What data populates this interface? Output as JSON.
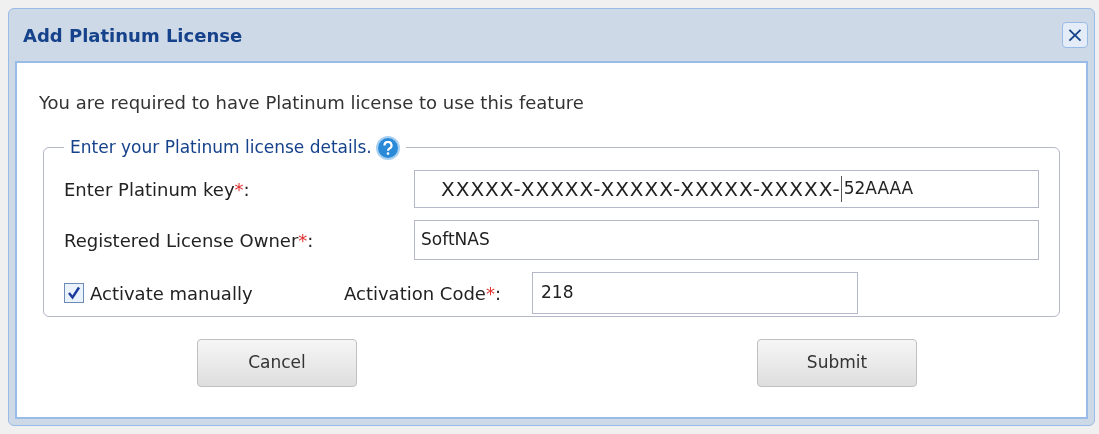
{
  "window": {
    "title": "Add Platinum License",
    "close": "×"
  },
  "message": "You are required to have Platinum license to use this feature",
  "fieldset": {
    "legend": "Enter your Platinum license details.",
    "fields": [
      {
        "label": "Enter Platinum key",
        "required": "*",
        "colon": ":",
        "value": "XXXXX-XXXXX-XXXXX-XXXXX-XXXXX-",
        "value_end": "52AAAA"
      },
      {
        "label": "Registered License Owner",
        "required": "*",
        "colon": ":",
        "value": "SoftNAS"
      }
    ],
    "activate": {
      "label": "Activate manually",
      "checked": true
    },
    "activation_code": {
      "label": "Activation Code",
      "required": "*",
      "colon": ":",
      "value": "218"
    }
  },
  "buttons": [
    "Cancel",
    "Submit"
  ]
}
